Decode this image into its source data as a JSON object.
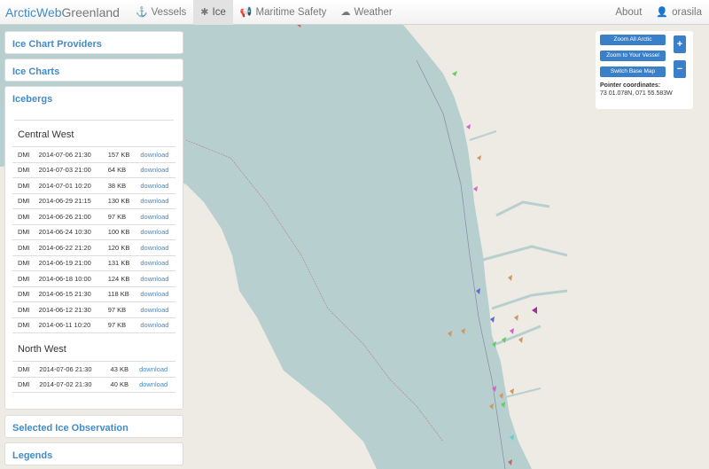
{
  "nav": {
    "brand_part1": "ArcticWeb",
    "brand_part2": "Greenland",
    "vessels_icon": "anchor-icon",
    "vessels": "Vessels",
    "ice_icon": "asterisk-icon",
    "ice": "Ice",
    "maritime_icon": "bullhorn-icon",
    "maritime": "Maritime Safety",
    "weather_icon": "cloud-icon",
    "weather": "Weather",
    "about": "About",
    "user_icon": "user-icon",
    "user": "orasila"
  },
  "panels": {
    "providers": "Ice Chart Providers",
    "charts": "Ice Charts",
    "icebergs": "Icebergs",
    "selected": "Selected Ice Observation",
    "legends": "Legends"
  },
  "icebergs": {
    "central_west": {
      "title": "Central West",
      "rows": [
        {
          "provider": "DMI",
          "date": "2014-07-06 21:30",
          "size": "157 KB",
          "action": "download"
        },
        {
          "provider": "DMI",
          "date": "2014-07-03 21:00",
          "size": "64 KB",
          "action": "download"
        },
        {
          "provider": "DMI",
          "date": "2014-07-01 10:20",
          "size": "38 KB",
          "action": "download"
        },
        {
          "provider": "DMI",
          "date": "2014-06-29 21:15",
          "size": "130 KB",
          "action": "download"
        },
        {
          "provider": "DMI",
          "date": "2014-06-26 21:00",
          "size": "97 KB",
          "action": "download"
        },
        {
          "provider": "DMI",
          "date": "2014-06-24 10:30",
          "size": "100 KB",
          "action": "download"
        },
        {
          "provider": "DMI",
          "date": "2014-06-22 21:20",
          "size": "120 KB",
          "action": "download"
        },
        {
          "provider": "DMI",
          "date": "2014-06-19 21:00",
          "size": "131 KB",
          "action": "download"
        },
        {
          "provider": "DMI",
          "date": "2014-06-18 10:00",
          "size": "124 KB",
          "action": "download"
        },
        {
          "provider": "DMI",
          "date": "2014-06-15 21:30",
          "size": "118 KB",
          "action": "download"
        },
        {
          "provider": "DMI",
          "date": "2014-06-12 21:30",
          "size": "97 KB",
          "action": "download"
        },
        {
          "provider": "DMI",
          "date": "2014-06-11 10:20",
          "size": "97 KB",
          "action": "download"
        }
      ]
    },
    "north_west": {
      "title": "North West",
      "rows": [
        {
          "provider": "DMI",
          "date": "2014-07-06 21:30",
          "size": "43 KB",
          "action": "download"
        },
        {
          "provider": "DMI",
          "date": "2014-07-02 21:30",
          "size": "40 KB",
          "action": "download"
        }
      ]
    }
  },
  "map_controls": {
    "zoom_all": "Zoom All Arctic",
    "zoom_vessel": "Zoom to Your Vessel",
    "switch_base": "Switch Base Map",
    "pointer_label": "Pointer coordinates:",
    "pointer_value": "73 01.078N, 071 55.583W",
    "zoom_in": "+",
    "zoom_out": "−"
  },
  "colors": {
    "accent": "#428bca",
    "button": "#3a80c8",
    "sea": "#b8cfcf",
    "land": "#eeebe4"
  }
}
